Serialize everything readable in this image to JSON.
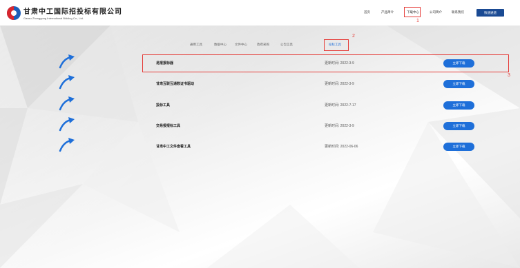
{
  "header": {
    "brand_cn": "甘肃中工国际招投标有限公司",
    "brand_en": "Gansu Zhonggong International Bidding Co., Ltd.",
    "nav": [
      "首页",
      "产品简介",
      "下载中心",
      "公司简介",
      "联系我们"
    ],
    "cta_label": "快速通道"
  },
  "annotations": {
    "one": "1",
    "two": "2",
    "three": "3"
  },
  "tabs": [
    "通用工具",
    "数据中心",
    "文件中心",
    "政府采购",
    "公告信息",
    "投标工具"
  ],
  "active_tab_index": 5,
  "downloads": [
    {
      "name": "易报报标器",
      "date": "更新时间: 2022-3-9",
      "button": "立即下载"
    },
    {
      "name": "甘肃互联互通数证书驱动",
      "date": "更新时间: 2022-3-9",
      "button": "立即下载"
    },
    {
      "name": "投标工具",
      "date": "更新时间: 2022-7-17",
      "button": "立即下载"
    },
    {
      "name": "交易报报标工具",
      "date": "更新时间: 2022-3-9",
      "button": "立即下载"
    },
    {
      "name": "甘肃中工文件查看工具",
      "date": "更新时间: 2022-06-06",
      "button": "立即下载"
    }
  ],
  "colors": {
    "accent": "#1e6fd9",
    "highlight": "#e53935",
    "brand_dark": "#1a4a93"
  }
}
